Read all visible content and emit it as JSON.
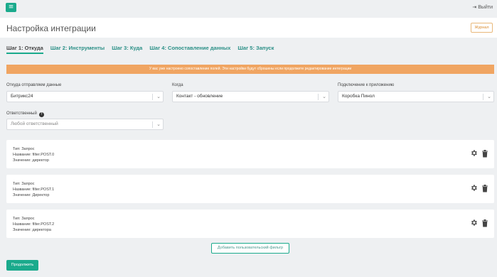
{
  "topbar": {
    "menu_icon": "hamburger-icon",
    "logout_icon": "logout-icon",
    "logout_label": "Выйти"
  },
  "header": {
    "title": "Настройка интеграции",
    "journal_label": "Журнал"
  },
  "tabs": [
    {
      "label": "Шаг 1: Откуда",
      "active": true
    },
    {
      "label": "Шаг 2: Инструменты",
      "active": false
    },
    {
      "label": "Шаг 3: Куда",
      "active": false
    },
    {
      "label": "Шаг 4: Сопоставление данных",
      "active": false
    },
    {
      "label": "Шаг 5: Запуск",
      "active": false
    }
  ],
  "warning": {
    "text": "У вас уже настроено сопоставление полей. Эти настройки будут сброшены если продолжите редактирование интеграции",
    "color": "#f0a562"
  },
  "form": {
    "source": {
      "label": "Откуда отправляем данные",
      "value": "Битрикс24"
    },
    "when": {
      "label": "Когда",
      "value": "Контакт - обновление"
    },
    "connection": {
      "label": "Подключение к приложению",
      "value": "Коробка Пинол"
    },
    "responsible": {
      "label": "Ответственный",
      "help_icon": "question-circle-icon",
      "placeholder": "Любой ответственный"
    }
  },
  "filters": [
    {
      "type": "Тип: Запрос",
      "name": "Название: filter.POST.0",
      "value": "Значение: директор"
    },
    {
      "type": "Тип: Запрос",
      "name": "Название: filter.POST.1",
      "value": "Значение: Директор"
    },
    {
      "type": "Тип: Запрос",
      "name": "Название: filter.POST.2",
      "value": "Значение: директора"
    }
  ],
  "actions": {
    "add_filter_label": "Добавить пользовательский фильтр",
    "continue_label": "Продолжить"
  },
  "colors": {
    "accent": "#1aaa8c",
    "warning": "#f0a562",
    "journal": "#d98a2b"
  }
}
